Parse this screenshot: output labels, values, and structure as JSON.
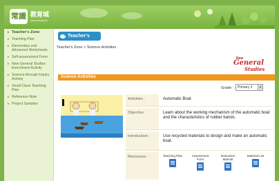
{
  "header": {
    "logo_mark": "常識",
    "logo_name": "教育城",
    "logo_url": "www.edcity.hk",
    "zone_badge": "Teacher's Zone",
    "breadcrumb": "Teacher's Zone > Science Activities"
  },
  "brand": {
    "new": "New",
    "general": "General",
    "studies": "Studies"
  },
  "sidebar": {
    "items": [
      {
        "label": "Teacher's Zone",
        "active": true
      },
      {
        "label": "Teaching Plan"
      },
      {
        "label": "Elementary and Advanced Worksheets"
      },
      {
        "label": "Self-assessment Form"
      },
      {
        "label": "New General Studies Enrichment Activity"
      },
      {
        "label": "Science through Inquiry Activity"
      },
      {
        "label": "Small Class Teaching Plan"
      },
      {
        "label": "Reference Note"
      },
      {
        "label": "Project Samples"
      }
    ]
  },
  "section": {
    "title": "Science Activities"
  },
  "grade": {
    "label": "Grade :",
    "selected": "Primary 3"
  },
  "details": {
    "activities_label": "Activities :",
    "activities_value": "Automatic Boat",
    "objective_label": "Objective :",
    "objective_value": "Learn about the working mechanism of the automatic boat and the characteristics of rubber bands.",
    "introduction_label": "Introduction :",
    "introduction_value": "Use recycled materials to design and make an automatic boat.",
    "resources_label": "Resources :",
    "resources": [
      {
        "label": "Teaching Plan"
      },
      {
        "label": "Assessment Form"
      },
      {
        "label": "Instruction Manual"
      },
      {
        "label": "Material List"
      }
    ]
  },
  "colors": {
    "header_green": "#79b33f",
    "zone_blue": "#2a8fc9",
    "section_orange": "#f0981f",
    "brand_red": "#c62828"
  }
}
